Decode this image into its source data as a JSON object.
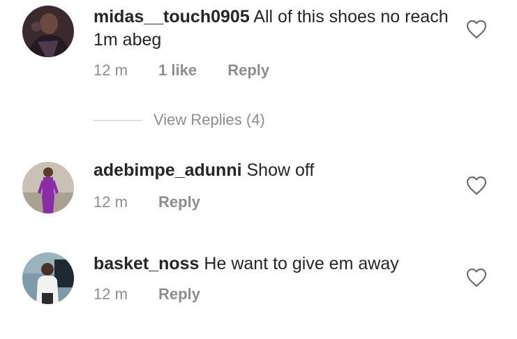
{
  "comments": [
    {
      "username": "midas__touch0905",
      "text": "All of this shoes no reach 1m abeg",
      "time": "12 m",
      "likes": "1 like",
      "reply": "Reply"
    },
    {
      "username": "adebimpe_adunni",
      "text": "Show off",
      "time": "12 m",
      "reply": "Reply"
    },
    {
      "username": "basket_noss",
      "text": "He want to give em away",
      "time": "12 m",
      "reply": "Reply"
    }
  ],
  "view_replies": "View Replies (4)",
  "colors": {
    "text": "#262626",
    "meta": "#8e8e8e",
    "divider": "#c7c7c7"
  }
}
